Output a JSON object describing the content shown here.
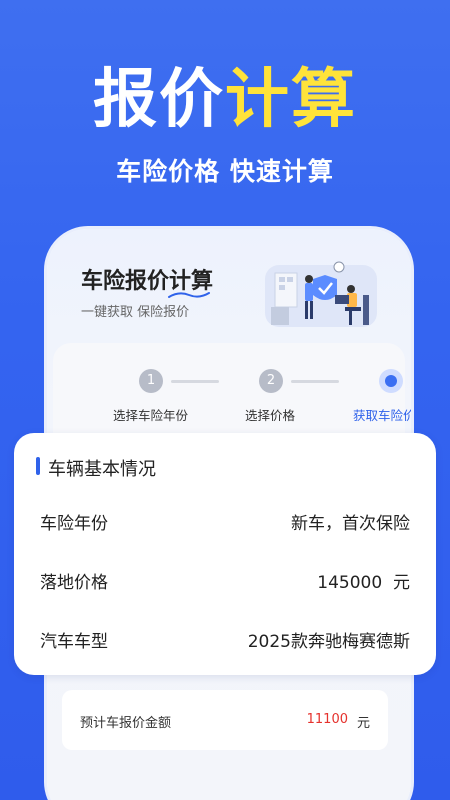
{
  "hero": {
    "title_white": "报价",
    "title_yellow": "计算",
    "subtitle": "车险价格 快速计算"
  },
  "phone": {
    "title": "车险报价计算",
    "subtitle": "一键获取 保险报价",
    "steps": [
      {
        "number": "1",
        "label": "选择车险年份"
      },
      {
        "number": "2",
        "label": "选择价格"
      },
      {
        "number": "",
        "label": "获取车险价格"
      }
    ]
  },
  "vehicle_info": {
    "heading": "车辆基本情况",
    "rows": [
      {
        "label": "车险年份",
        "value": "新车，首次保险"
      },
      {
        "label": "落地价格",
        "value": "145000  元"
      },
      {
        "label": "汽车车型",
        "value": "2025款奔驰梅赛德斯"
      }
    ]
  },
  "estimate": {
    "label": "预计车报价金额",
    "amount": "11100",
    "unit": "元"
  },
  "colors": {
    "background": "#3464f0",
    "accent_yellow": "#ffe33a",
    "primary_blue": "#2f62ea",
    "amount_red": "#e5322d"
  }
}
